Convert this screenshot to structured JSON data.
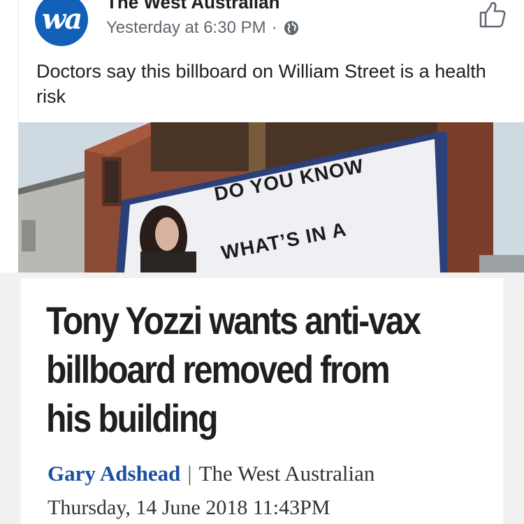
{
  "post": {
    "page_name": "The West Australian",
    "avatar_monogram": "wa",
    "timestamp": "Yesterday at 6:30 PM",
    "separator": "·",
    "visibility_icon": "globe-icon",
    "like_icon": "thumbs-up-icon",
    "text": "Doctors say this billboard on William Street is a health risk"
  },
  "photo": {
    "billboard_line1": "DO YOU KNOW",
    "billboard_line2": "WHAT’S IN A"
  },
  "article": {
    "headline": "Tony Yozzi wants anti-vax billboard removed from his building",
    "author": "Gary Adshead",
    "divider": "|",
    "publication": "The West Australian",
    "date": "Thursday, 14 June 2018 11:43PM"
  },
  "colors": {
    "brand_blue": "#1260b8",
    "author_link": "#1a4fa0",
    "meta_grey": "#606770"
  }
}
